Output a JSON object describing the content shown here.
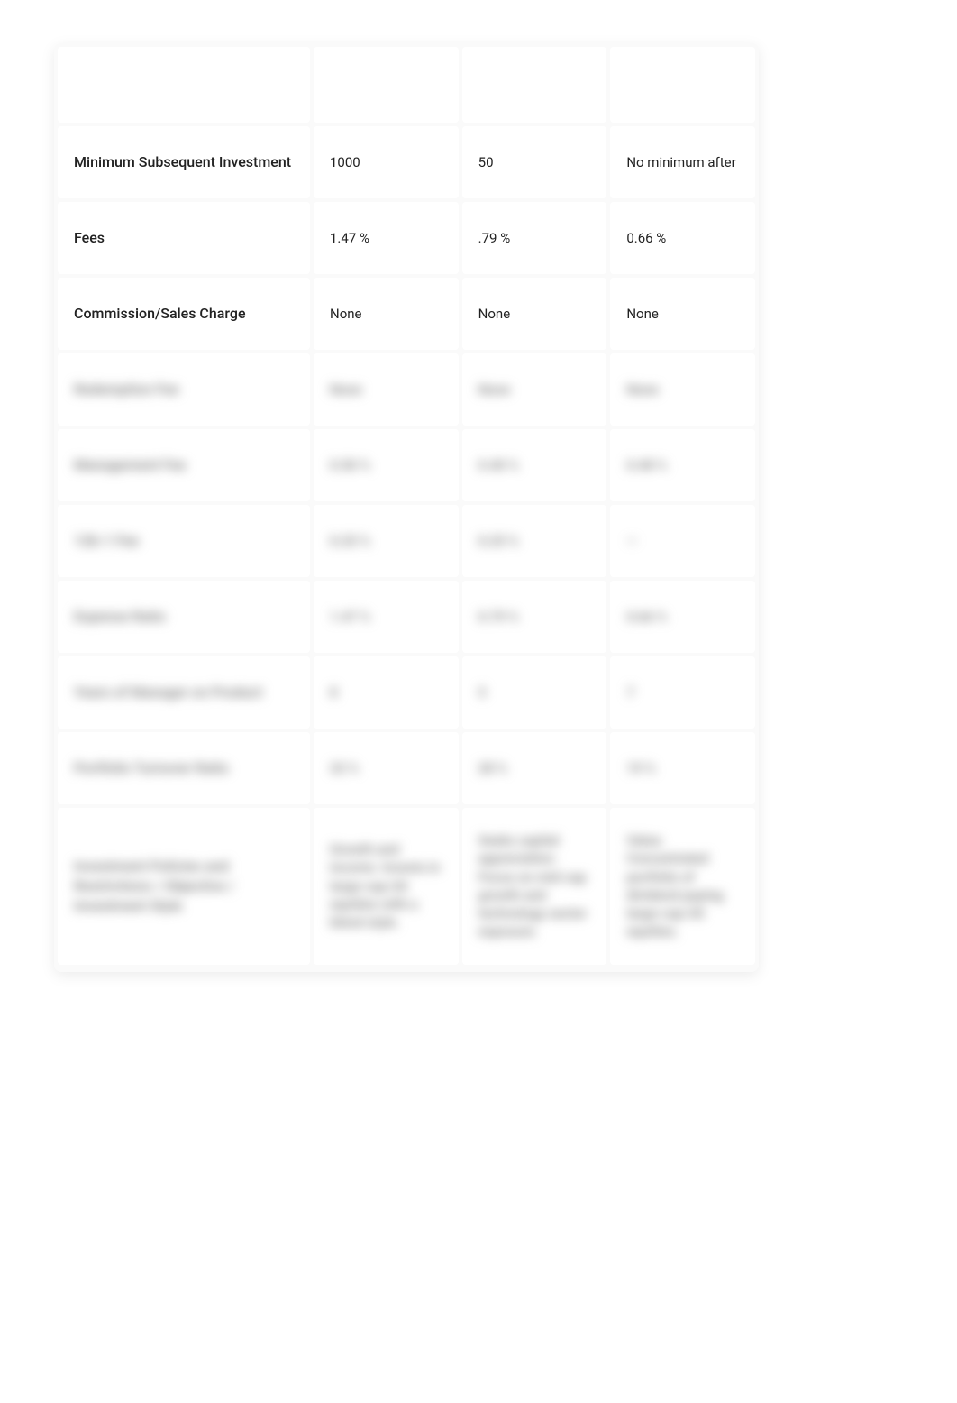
{
  "table": {
    "header_row": {
      "labels": [
        "",
        "",
        "",
        ""
      ]
    },
    "rows": [
      {
        "label": "Minimum Subsequent Investment",
        "cols": [
          "1000",
          "50",
          "No minimum after"
        ],
        "blurred": false
      },
      {
        "label": "Fees",
        "cols": [
          "1.47 %",
          ".79 %",
          "0.66 %"
        ],
        "blurred": false
      },
      {
        "label": "Commission/Sales Charge",
        "cols": [
          "None",
          "None",
          "None"
        ],
        "blurred_row": true
      },
      {
        "label": "Redemption Fee",
        "cols": [
          "None",
          "None",
          "None"
        ],
        "blurred": true
      },
      {
        "label": "Management Fee",
        "cols": [
          "0.50 %",
          "0.40 %",
          "0.48 %"
        ],
        "blurred": true
      },
      {
        "label": "12b-1 Fee",
        "cols": [
          "0.25 %",
          "0.25 %",
          "—"
        ],
        "blurred": true
      },
      {
        "label": "Expense Ratio",
        "cols": [
          "1.47 %",
          "0.79 %",
          "0.66 %"
        ],
        "blurred": true
      },
      {
        "label": "Years of Manager on Product",
        "cols": [
          "8",
          "5",
          "7"
        ],
        "blurred": true
      },
      {
        "label": "Portfolio Turnover Ratio",
        "cols": [
          "32 %",
          "28 %",
          "19 %"
        ],
        "blurred": true
      },
      {
        "label": "Investment Policies and Restrictions / Objective / Investment Style",
        "cols": [
          "Growth and income. Invests in large-cap US equities with a blend style.",
          "Seeks capital appreciation. Focus on mid-cap growth and technology sector exposure.",
          "Value. Concentrated portfolio of dividend-paying large-cap US equities."
        ],
        "blurred": true,
        "tall": true
      }
    ]
  }
}
